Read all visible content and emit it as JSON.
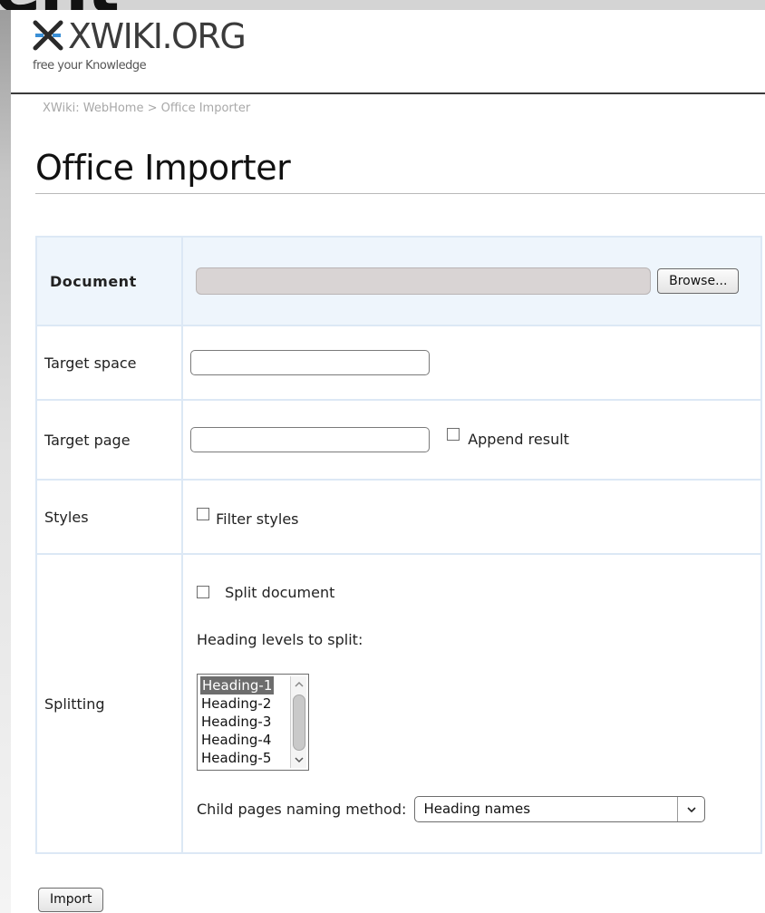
{
  "top_bar": {
    "cropped_text": "ent"
  },
  "logo": {
    "name": "XWIKI.ORG",
    "tagline": "free your Knowledge"
  },
  "breadcrumb": "XWiki: WebHome > Office Importer",
  "page_title": "Office Importer",
  "form": {
    "document": {
      "label": "Document",
      "browse_label": "Browse..."
    },
    "target_space": {
      "label": "Target space",
      "value": ""
    },
    "target_page": {
      "label": "Target page",
      "value": "",
      "append_label": "Append result",
      "append_checked": false
    },
    "styles": {
      "label": "Styles",
      "filter_label": "Filter styles",
      "filter_checked": false
    },
    "splitting": {
      "label": "Splitting",
      "split_label": "Split document",
      "split_checked": false,
      "heading_levels_label": "Heading levels to split:",
      "heading_levels": [
        "Heading-1",
        "Heading-2",
        "Heading-3",
        "Heading-4",
        "Heading-5"
      ],
      "selected_heading": "Heading-1",
      "naming_label": "Child pages naming method:",
      "naming_value": "Heading names"
    }
  },
  "import_label": "Import",
  "colors": {
    "accent": "#3a8fd6",
    "row_border": "#dce8f5",
    "doc_row_bg": "#eef5fc"
  }
}
